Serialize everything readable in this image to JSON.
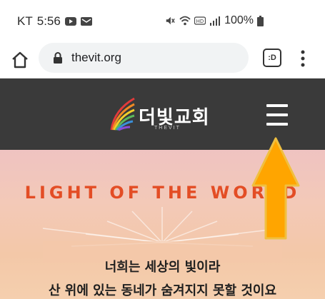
{
  "status_bar": {
    "carrier": "KT",
    "time": "5:56",
    "battery": "100%",
    "icons": [
      "youtube-icon",
      "mail-icon",
      "mute-icon",
      "wifi-icon",
      "hd-icon",
      "signal-icon",
      "battery-icon"
    ]
  },
  "browser": {
    "url": "thevit.org",
    "tab_label": ":D",
    "icons": [
      "home-icon",
      "lock-icon",
      "menu-dots-icon"
    ]
  },
  "site": {
    "logo_text": "더빛교회",
    "logo_sub": "THEVIT",
    "header_color": "#3a3a3a",
    "menu_icon": "hamburger-icon"
  },
  "hero": {
    "title": "LIGHT OF THE WORLD",
    "title_color": "#e34d25",
    "line1": "너희는 세상의 빛이라",
    "line2": "산 위에 있는 동네가 숨겨지지 못할 것이요"
  },
  "annotation": {
    "arrow_color": "#ffa500",
    "arrow_icon": "up-arrow-icon"
  }
}
